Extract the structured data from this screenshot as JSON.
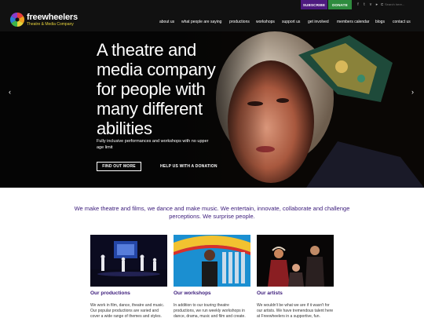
{
  "brand": {
    "name": "freewheelers",
    "tagline": "Theatre & Media Company"
  },
  "topbar": {
    "subscribe_label": "SUBSCRIBE",
    "donate_label": "DONATE",
    "search_placeholder": "Search here...",
    "social_icons": [
      "facebook-icon",
      "twitter-icon",
      "vimeo-icon",
      "youtube-icon",
      "instagram-icon"
    ]
  },
  "nav": {
    "items": [
      "about us",
      "what people are saying",
      "productions",
      "workshops",
      "support us",
      "get involved",
      "members calendar",
      "blogs",
      "contact us"
    ]
  },
  "hero": {
    "title": "A theatre and media company for people with many different abilities",
    "subtitle": "Fully inclusive performances and workshops with no upper age limit",
    "cta_label": "FIND OUT MORE",
    "donate_link": "HELP US WITH A DONATION",
    "prev_arrow": "‹",
    "next_arrow": "›"
  },
  "intro": {
    "text": "We make theatre and films, we dance and make music. We entertain, innovate, collaborate and challenge perceptions. We surprise people."
  },
  "cards": [
    {
      "title": "Our productions",
      "text": "We work in film, dance, theatre and music. Our popular productions are varied and cover a wide range of themes and styles."
    },
    {
      "title": "Our workshops",
      "text": "In addition to our touring theatre productions, we run weekly workshops in dance, drama, music and film and create."
    },
    {
      "title": "Our artists",
      "text": "We wouldn't be what we are if it wasn't for our artists. We have tremendous talent here at Freewheelers in a supportive, fun."
    }
  ],
  "colors": {
    "header_bg": "#111111",
    "subscribe_bg": "#4d1a7f",
    "donate_bg": "#2e8b3e",
    "accent_purple": "#3a1a7a",
    "logo_yellow": "#e6d23a"
  }
}
